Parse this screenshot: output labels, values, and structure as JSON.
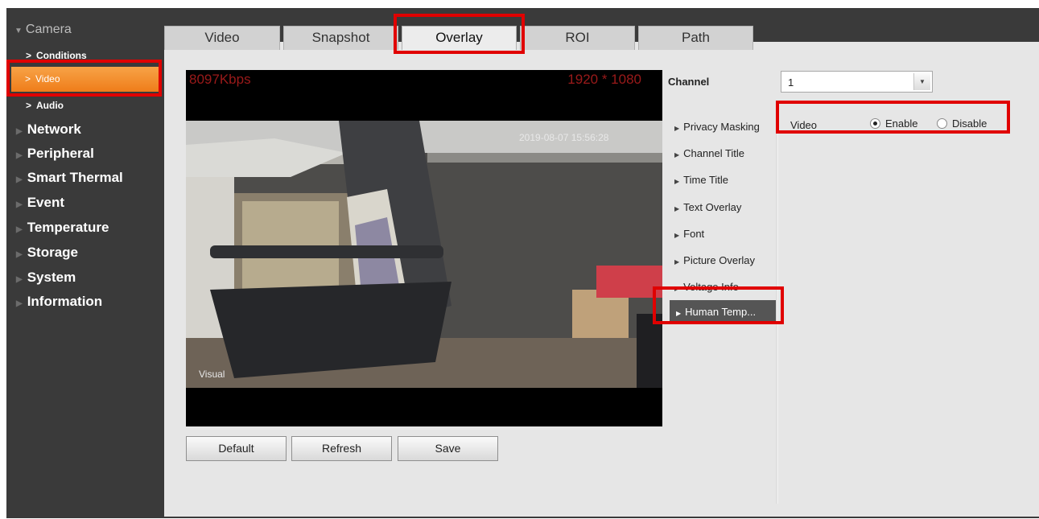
{
  "sidebar": {
    "section": "Camera",
    "sub_items": [
      {
        "label": "Conditions"
      },
      {
        "label": "Video"
      },
      {
        "label": "Audio"
      }
    ],
    "active_sub": "Video",
    "main_items": [
      {
        "label": "Network"
      },
      {
        "label": "Peripheral"
      },
      {
        "label": "Smart Thermal"
      },
      {
        "label": "Event"
      },
      {
        "label": "Temperature"
      },
      {
        "label": "Storage"
      },
      {
        "label": "System"
      },
      {
        "label": "Information"
      }
    ]
  },
  "tabs": [
    {
      "label": "Video"
    },
    {
      "label": "Snapshot"
    },
    {
      "label": "Overlay"
    },
    {
      "label": "ROI"
    },
    {
      "label": "Path"
    }
  ],
  "active_tab": "Overlay",
  "preview": {
    "bitrate": "8097Kbps",
    "resolution": "1920 * 1080",
    "datetime": "2019-08-07 15:56:28",
    "channel_name": "Visual"
  },
  "buttons": {
    "default": "Default",
    "refresh": "Refresh",
    "save": "Save"
  },
  "channel": {
    "label": "Channel",
    "value": "1"
  },
  "submenu": [
    {
      "label": "Privacy Masking"
    },
    {
      "label": "Channel Title"
    },
    {
      "label": "Time Title"
    },
    {
      "label": "Text Overlay"
    },
    {
      "label": "Font"
    },
    {
      "label": "Picture Overlay"
    },
    {
      "label": "Voltage Info"
    }
  ],
  "submenu_active": "Human Temp...",
  "setting": {
    "label": "Video",
    "enable": "Enable",
    "disable": "Disable",
    "selected": "Enable"
  },
  "colors": {
    "highlight": "#e00000",
    "active_nav": "#f08a2a",
    "panel": "#e6e6e6",
    "frame": "#3a3a3a"
  }
}
